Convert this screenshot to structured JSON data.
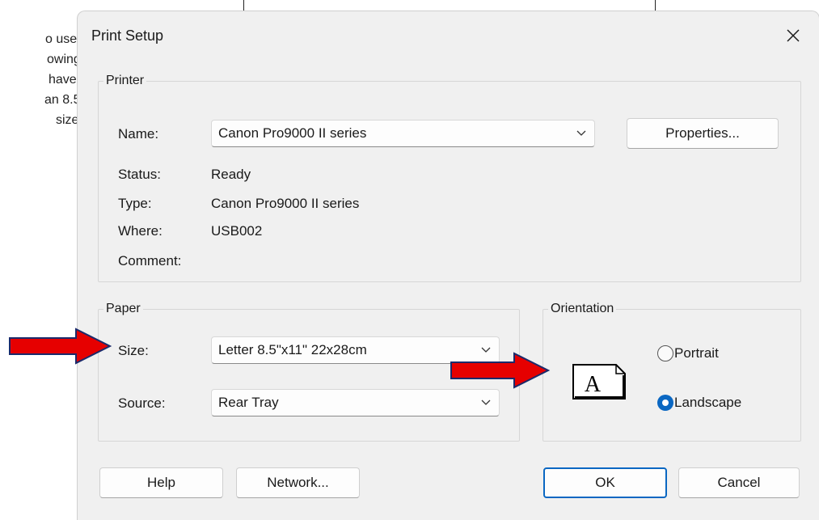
{
  "background_text": [
    "o use",
    "owing",
    "have",
    "an 8.5",
    "size"
  ],
  "dialog": {
    "title": "Print Setup",
    "close_icon": "close-icon"
  },
  "printer": {
    "legend": "Printer",
    "name_label": "Name:",
    "name_value": "Canon Pro9000 II series",
    "properties_button": "Properties...",
    "status_label": "Status:",
    "status_value": "Ready",
    "type_label": "Type:",
    "type_value": "Canon Pro9000 II series",
    "where_label": "Where:",
    "where_value": "USB002",
    "comment_label": "Comment:",
    "comment_value": ""
  },
  "paper": {
    "legend": "Paper",
    "size_label": "Size:",
    "size_value": "Letter 8.5\"x11\" 22x28cm",
    "source_label": "Source:",
    "source_value": "Rear Tray"
  },
  "orientation": {
    "legend": "Orientation",
    "preview_icon": "page-landscape-icon",
    "portrait_label": "Portrait",
    "landscape_label": "Landscape",
    "selected": "Landscape"
  },
  "buttons": {
    "help": "Help",
    "network": "Network...",
    "ok": "OK",
    "cancel": "Cancel"
  },
  "colors": {
    "accent": "#0a67c2",
    "annotation_arrow": "#e60000",
    "dialog_bg": "#f0f0f0"
  }
}
